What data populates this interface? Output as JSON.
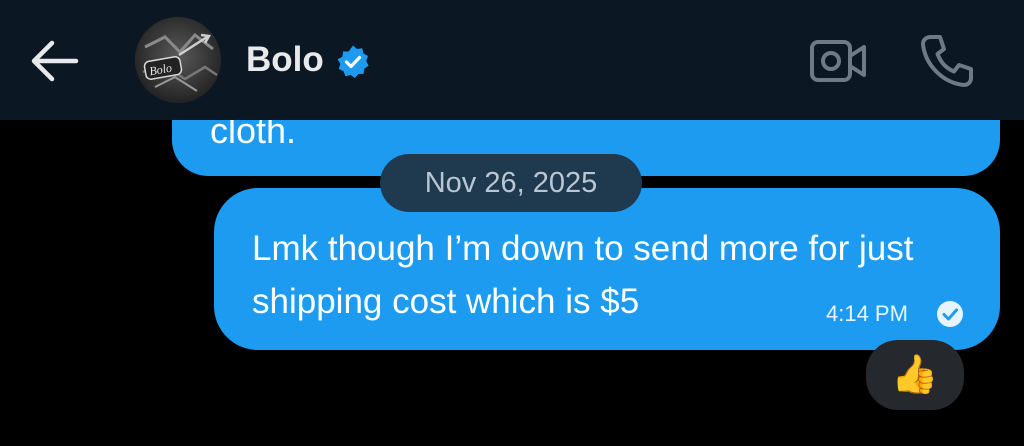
{
  "header": {
    "contact_name": "Bolo",
    "avatar_text": "Bolo"
  },
  "previous_message": {
    "text_fragment": "cloth."
  },
  "date_divider": "Nov 26, 2025",
  "message": {
    "text": "Lmk though I’m down to send more for just shipping cost which is $5",
    "time": "4:14 PM"
  },
  "reaction": {
    "emoji": "👍"
  },
  "colors": {
    "bubble": "#1d9bf0",
    "header_bg": "#0b1824",
    "date_pill_bg": "#1f3a4f",
    "verified": "#1d9bf0"
  },
  "icons": [
    "back-arrow-icon",
    "verified-badge-icon",
    "video-call-icon",
    "phone-icon",
    "read-check-icon"
  ]
}
